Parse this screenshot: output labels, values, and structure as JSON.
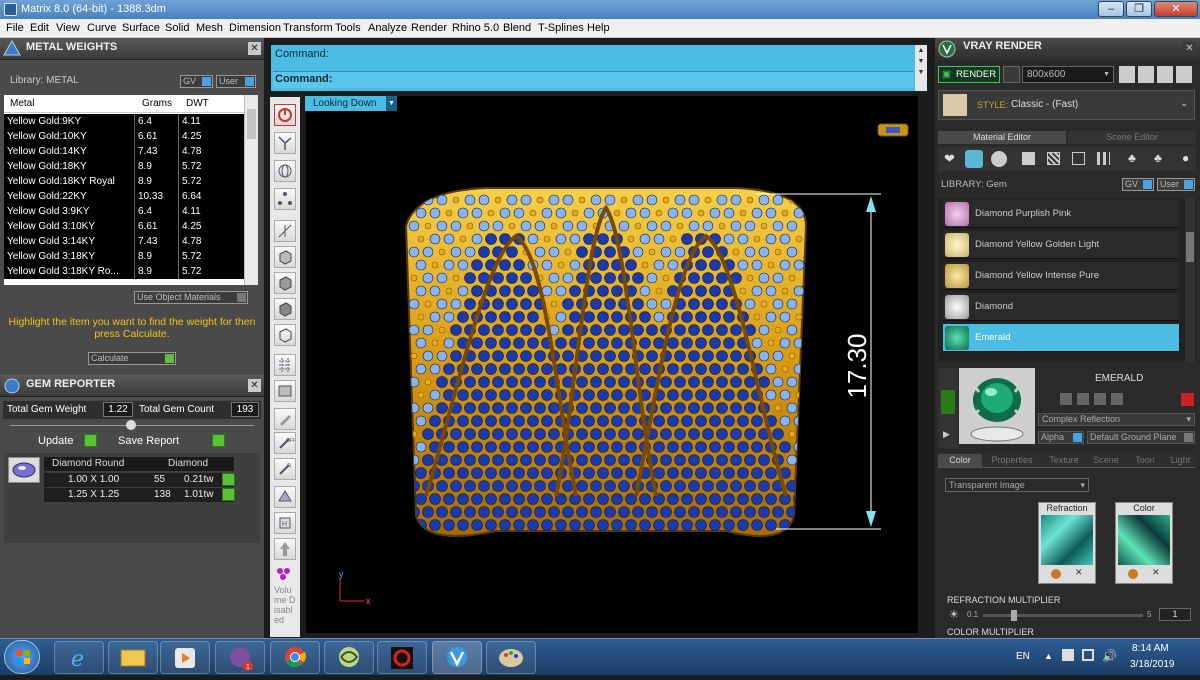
{
  "window": {
    "title": "Matrix 8.0 (64-bit) - 1388.3dm",
    "minimize": "–",
    "restore": "❐",
    "close": "✕"
  },
  "menu": [
    "File",
    "Edit",
    "View",
    "Curve",
    "Surface",
    "Solid",
    "Mesh",
    "Dimension",
    "Transform",
    "Tools",
    "Analyze",
    "Render",
    "Rhino 5.0",
    "Blend",
    "T-Splines",
    "Help"
  ],
  "metal_weights": {
    "title": "METAL WEIGHTS",
    "library_label": "Library: METAL",
    "gv": "GV",
    "user": "User",
    "columns": [
      "Metal",
      "Grams",
      "DWT"
    ],
    "rows": [
      [
        "Yellow Gold:9KY",
        "6.4",
        "4.11"
      ],
      [
        "Yellow Gold:10KY",
        "6.61",
        "4.25"
      ],
      [
        "Yellow Gold:14KY",
        "7.43",
        "4.78"
      ],
      [
        "Yellow Gold:18KY",
        "8.9",
        "5.72"
      ],
      [
        "Yellow Gold:18KY Royal",
        "8.9",
        "5.72"
      ],
      [
        "Yellow Gold:22KY",
        "10.33",
        "6.64"
      ],
      [
        "Yellow Gold 3:9KY",
        "6.4",
        "4.11"
      ],
      [
        "Yellow Gold 3:10KY",
        "6.61",
        "4.25"
      ],
      [
        "Yellow Gold 3:14KY",
        "7.43",
        "4.78"
      ],
      [
        "Yellow Gold 3:18KY",
        "8.9",
        "5.72"
      ],
      [
        "Yellow Gold 3:18KY Ro...",
        "8.9",
        "5.72"
      ]
    ],
    "use_object_materials": "Use Object Materials",
    "hint": "Highlight the item you want to find the weight for then press Calculate.",
    "calculate": "Calculate"
  },
  "gem_reporter": {
    "title": "GEM REPORTER",
    "total_weight_label": "Total Gem Weight",
    "total_weight": "1.22",
    "total_count_label": "Total Gem Count",
    "total_count": "193",
    "update": "Update",
    "save_report": "Save Report",
    "gem_shape": "Diamond Round",
    "gem_type": "Diamond",
    "rows": [
      [
        "1.00 X 1.00",
        "55",
        "0.21tw"
      ],
      [
        "1.25 X 1.25",
        "138",
        "1.01tw"
      ]
    ]
  },
  "command": {
    "line1": "Command:",
    "line2": "Command:"
  },
  "viewport": {
    "label": "Looking Down",
    "dimension": "17.30",
    "axis_y": "y",
    "axis_x": "x",
    "disabled_text": "Volume Disabled"
  },
  "vray": {
    "title": "VRAY RENDER",
    "render": "RENDER",
    "resolution": "800x600",
    "style_label": "STYLE:",
    "style_value": "Classic - (Fast)",
    "tabs": [
      "Material Editor",
      "Scene Editor"
    ],
    "library_label": "LIBRARY: Gem",
    "gv": "GV",
    "user": "User",
    "materials": [
      "Diamond Purplish Pink",
      "Diamond Yellow Golden Light",
      "Diamond Yellow Intense Pure",
      "Diamond",
      "Emerald"
    ],
    "selected": "EMERALD",
    "reflection": "Complex Reflection",
    "alpha": "Alpha",
    "ground": "Default Ground Plane",
    "subtabs": [
      "Color",
      "Properties",
      "Texture",
      "Scene",
      "Toon",
      "Light"
    ],
    "transparent": "Transparent Image",
    "refraction": "Refraction",
    "color": "Color",
    "refraction_multiplier": "REFRACTION MULTIPLIER",
    "slider_min": "0.1",
    "slider_max": "5",
    "slider_value": "1",
    "color_multiplier": "COLOR MULTIPLIER"
  },
  "taskbar": {
    "lang": "EN",
    "time": "8:14 AM",
    "date": "3/18/2019",
    "badge": "1"
  },
  "colors": {
    "accent": "#4bbde3",
    "gold": "#e4ac1e",
    "sapphire": "#1c3aa8",
    "light_blue": "#8ab4f0",
    "emerald": "#19a07a",
    "hint": "#f2c21d"
  }
}
